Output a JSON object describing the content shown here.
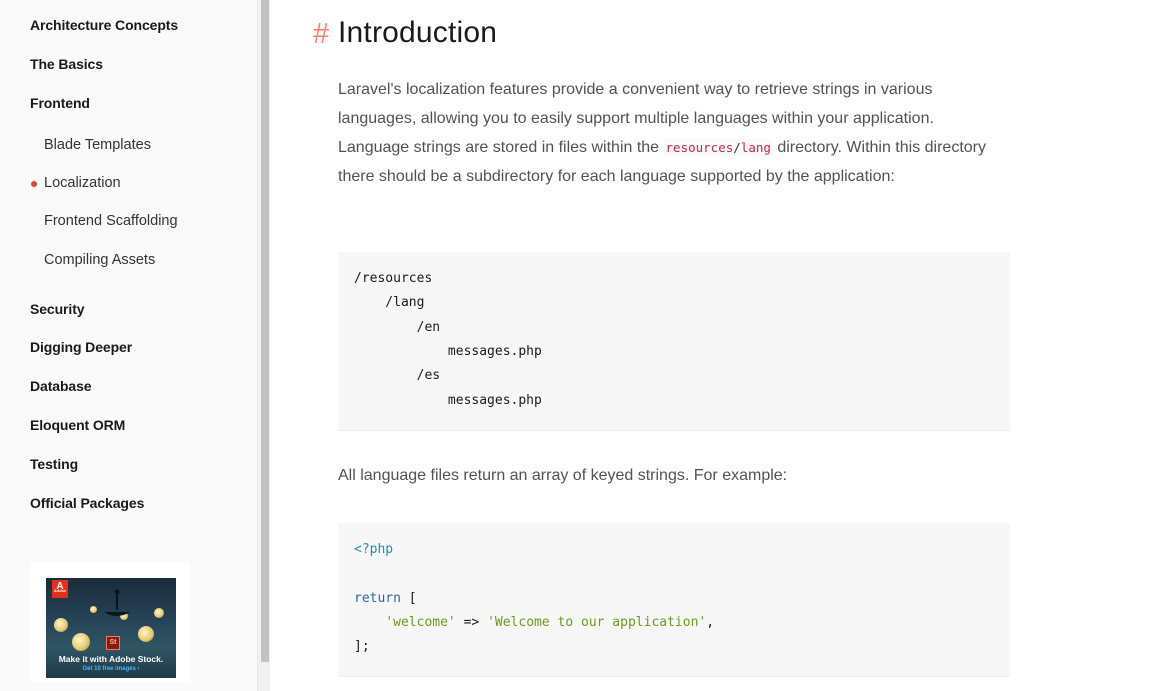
{
  "sidebar": {
    "items": [
      {
        "label": "Architecture Concepts"
      },
      {
        "label": "The Basics"
      },
      {
        "label": "Frontend"
      },
      {
        "label": "Security"
      },
      {
        "label": "Digging Deeper"
      },
      {
        "label": "Database"
      },
      {
        "label": "Eloquent ORM"
      },
      {
        "label": "Testing"
      },
      {
        "label": "Official Packages"
      }
    ],
    "frontend_children": [
      {
        "label": "Blade Templates"
      },
      {
        "label": "Localization",
        "active": true
      },
      {
        "label": "Frontend Scaffolding"
      },
      {
        "label": "Compiling Assets"
      }
    ],
    "ad": {
      "logo_text": "Adobe",
      "badge_text": "St",
      "headline": "Make it with Adobe Stock.",
      "cta": "Get 10 free images ›"
    }
  },
  "main": {
    "heading_hash": "#",
    "heading": "Introduction",
    "para1_part1": "Laravel's localization features provide a convenient way to retrieve strings in various languages, allowing you to easily support multiple languages within your application. Language strings are stored in files within the ",
    "para1_code_a": "resources",
    "para1_code_sep": "/",
    "para1_code_b": "lang",
    "para1_part2": " directory. Within this directory there should be a subdirectory for each language supported by the application:",
    "code_tree": [
      "/resources",
      "    /lang",
      "        /en",
      "            messages.php",
      "        /es",
      "            messages.php"
    ],
    "para2": "All language files return an array of keyed strings. For example:",
    "code_php": {
      "open_tag": "<?php",
      "return_kw": "return",
      "open_bracket": " [",
      "indent": "    ",
      "key": "'welcome'",
      "arrow": " => ",
      "value": "'Welcome to our application'",
      "comma": ",",
      "close": "];"
    }
  },
  "colors": {
    "accent": "#ef3b2d",
    "sidebar_bg": "#fafafa",
    "code_bg": "#f7f7f7",
    "string": "#6a9a1f",
    "php_tag": "#1f8fb4"
  }
}
